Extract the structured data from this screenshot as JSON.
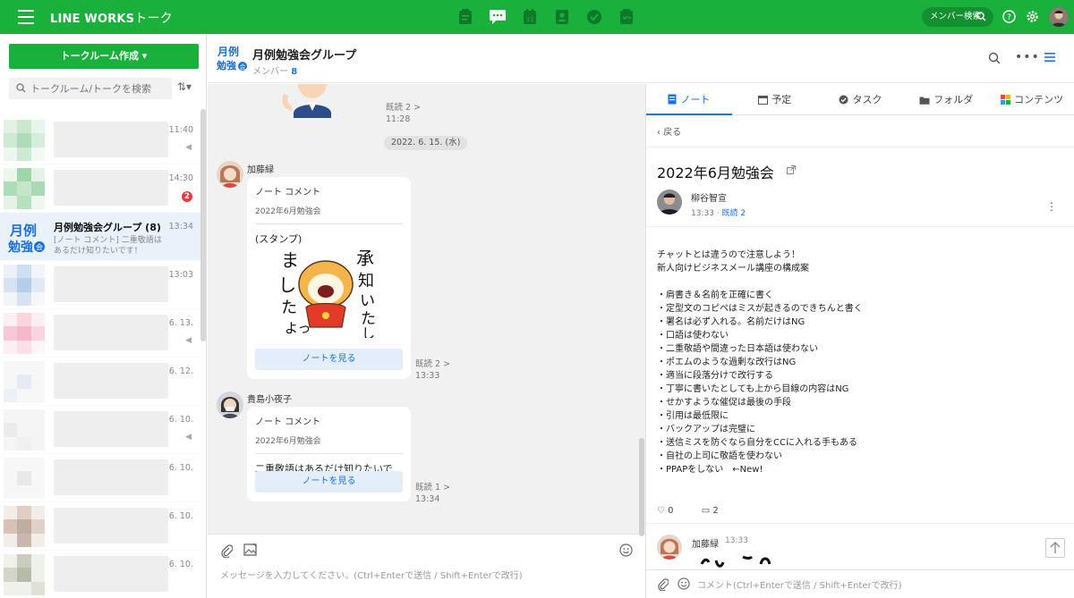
{
  "topbar": {
    "brand": "LINE WORKS",
    "brand_suffix": "トーク",
    "member_search": "メンバー検索"
  },
  "left": {
    "create_button": "トークルーム作成 ▾",
    "search_placeholder": "トークルーム/トークを検索",
    "sort_icon": "⇅▾",
    "items": [
      {
        "time": "11:40",
        "muted": true
      },
      {
        "time": "14:30",
        "badge": "2"
      },
      {
        "time": "13:34",
        "name": "月例勉強会グループ (8)",
        "preview": "[ノート コメント] 二重敬語はあるだけ知りたいです！",
        "active": true
      },
      {
        "time": "13:03"
      },
      {
        "time": "6. 13.",
        "muted": true
      },
      {
        "time": "6. 12."
      },
      {
        "time": "6. 10.",
        "muted": true
      },
      {
        "time": "6. 10."
      },
      {
        "time": "6. 10."
      },
      {
        "time": "6. 10."
      }
    ]
  },
  "chat_header": {
    "title": "月例勉強会グループ",
    "members_label": "メンバー",
    "members_count": "8"
  },
  "chat": {
    "first_read": "既読 2 >",
    "first_time": "11:28",
    "date": "2022. 6. 15. (水)",
    "msg1": {
      "sender": "加藤緑",
      "card_title": "ノート コメント",
      "card_sub": "2022年6月勉強会",
      "card_body": "(スタンプ)",
      "button": "ノートを見る",
      "read": "既読 2 >",
      "time": "13:33"
    },
    "msg2": {
      "sender": "貴島小夜子",
      "card_title": "ノート コメント",
      "card_sub": "2022年6月勉強会",
      "card_body": "二重敬語はあるだけ知りたいです！",
      "button": "ノートを見る",
      "read": "既読 1 >",
      "time": "13:34"
    },
    "placeholder": "メッセージを入力してください。(Ctrl+Enterで送信 / Shift+Enterで改行)"
  },
  "right": {
    "tabs": [
      "ノート",
      "予定",
      "タスク",
      "フォルダ",
      "コンテンツ"
    ],
    "back": "戻る",
    "note_title": "2022年6月勉強会",
    "author": "柳谷智宣",
    "author_time": "13:33",
    "author_read": "既読 2",
    "body": "チャットとは違うので注意しよう！\n新人向けビジネスメール講座の構成案\n\n・肩書き＆名前を正確に書く\n・定型文のコピペはミスが起きるのできちんと書く\n・署名は必ず入れる。名前だけはNG\n・口語は使わない\n・二重敬語や間違った日本語は使わない\n・ポエムのような過剰な改行はNG\n・適当に段落分けで改行する\n・丁寧に書いたとしても上から目線の内容はNG\n・せかすような催促は最後の手段\n・引用は最低限に\n・バックアップは完璧に\n・送信ミスを防ぐなら自分をCCに入れる手もある\n・自社の上司に敬語を使わない\n・PPAPをしない　←New!",
    "likes": "0",
    "comments": "2",
    "comment_author": "加藤緑",
    "comment_time": "13:33",
    "comment_placeholder": "コメント(Ctrl+Enterで送信 / Shift+Enterで改行)"
  },
  "colors": {
    "brand": "#19b03c",
    "accent": "#1a73e8",
    "badge": "#ea3b3b"
  }
}
